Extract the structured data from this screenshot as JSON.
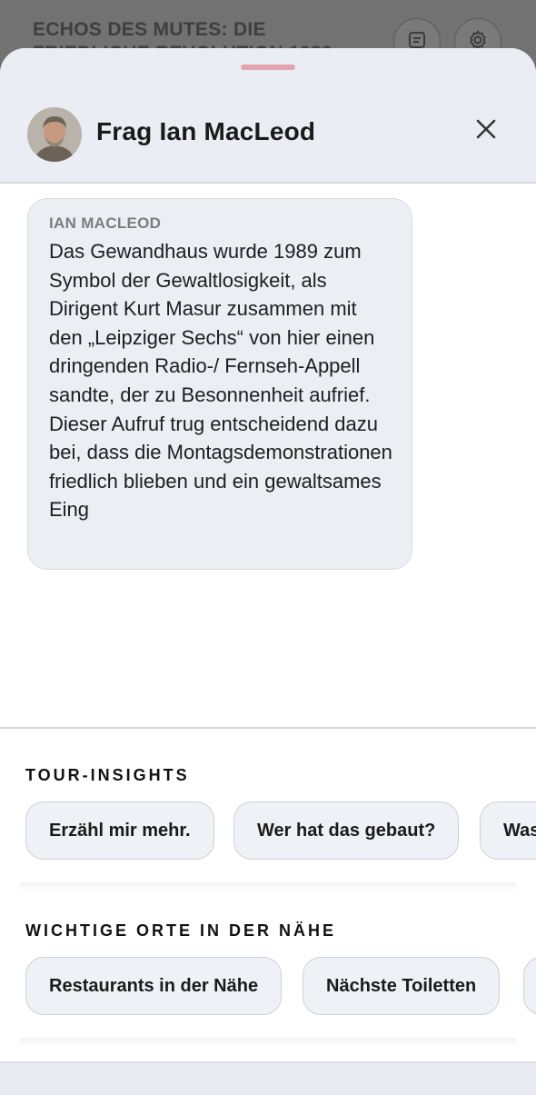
{
  "background_page": {
    "title": "ECHOS DES MUTES: DIE FRIEDLICHE REVOLUTION 1989",
    "icons": [
      "notes-icon",
      "gear-icon"
    ]
  },
  "sheet": {
    "title": "Frag Ian MacLeod",
    "close_icon": "close-icon",
    "avatar_alt": "Ian MacLeod"
  },
  "message": {
    "sender": "IAN MACLEOD",
    "text": "Das Gewandhaus wurde 1989 zum Symbol der Gewaltlosigkeit, als Dirigent Kurt Masur zusammen mit den „Leipziger Sechs“ von hier einen dringenden Radio-/ Fernseh-Appell sandte, der zu Besonnenheit aufrief. Dieser Aufruf trug entscheidend dazu bei, dass die Montagsdemonstrationen friedlich blieben und ein gewaltsames Eing"
  },
  "tour_insights": {
    "label": "TOUR-INSIGHTS",
    "chips": [
      "Erzähl mir mehr.",
      "Wer hat das gebaut?",
      "Was"
    ]
  },
  "nearby": {
    "label": "WICHTIGE ORTE IN DER NÄHE",
    "chips": [
      "Restaurants in der Nähe",
      "Nächste Toiletten",
      ""
    ]
  },
  "colors": {
    "sheet_header": "#eaeef4",
    "bubble": "#ebeef3",
    "chip": "#eef1f6",
    "handle": "#e2a5ad",
    "overlay": "#6e6e6e"
  }
}
